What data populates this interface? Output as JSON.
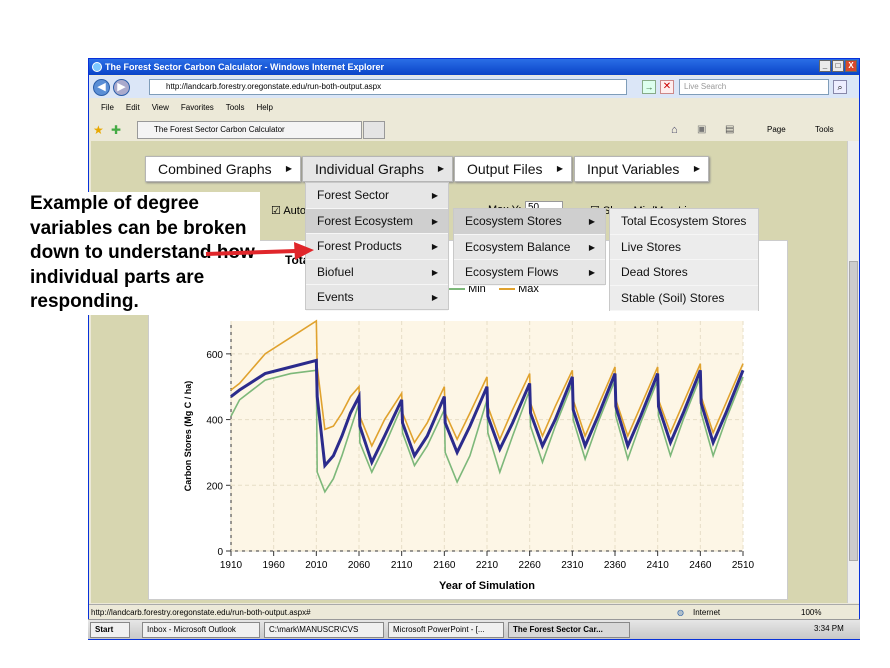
{
  "window": {
    "title": "The Forest Sector Carbon Calculator - Windows Internet Explorer",
    "controls": [
      "_",
      "□",
      "X"
    ]
  },
  "address": {
    "url": "http://landcarb.forestry.oregonstate.edu/run-both-output.aspx",
    "search_placeholder": "Live Search"
  },
  "menu": [
    "File",
    "Edit",
    "View",
    "Favorites",
    "Tools",
    "Help"
  ],
  "tab": {
    "label": "The Forest Sector Carbon Calculator"
  },
  "toolbar": {
    "page": "Page",
    "tools": "Tools"
  },
  "nav": [
    {
      "label": "Combined Graphs"
    },
    {
      "label": "Individual Graphs"
    },
    {
      "label": "Output Files"
    },
    {
      "label": "Input Variables"
    }
  ],
  "dropdown1": [
    "Forest Sector",
    "Forest Ecosystem",
    "Forest Products",
    "Biofuel",
    "Events"
  ],
  "dropdown2": [
    "Ecosystem Stores",
    "Ecosystem Balance",
    "Ecosystem Flows"
  ],
  "dropdown3": [
    "Total Ecosystem Stores",
    "Live Stores",
    "Dead Stores",
    "Stable (Soil) Stores"
  ],
  "partial": {
    "auto": "Auto",
    "maxy": "Max Y:",
    "maxy_value": "50",
    "showminmax": "Show Min/Max Lines",
    "title_fragment": "Tota",
    "legend_min": "Min",
    "legend_max": "Max"
  },
  "callout": "Example of degree variables can be broken down to understand how individual parts are responding.",
  "status": {
    "url": "http://landcarb.forestry.oregonstate.edu/run-both-output.aspx#",
    "zone": "Internet",
    "zoom": "100%"
  },
  "taskbar": {
    "start": "Start",
    "items": [
      "Inbox - Microsoft Outlook",
      "C:\\mark\\MANUSCR\\CVS",
      "Microsoft PowerPoint - [...",
      "The Forest Sector Car..."
    ],
    "time": "3:34 PM"
  },
  "colors": {
    "accent": "#e0262b",
    "mean": "#2b2b8c",
    "max": "#e0a22e",
    "min": "#7db87a"
  },
  "chart_data": {
    "type": "line",
    "xlabel": "Year of Simulation",
    "ylabel": "Carbon Stores (Mg C / ha)",
    "xlim": [
      1910,
      2510
    ],
    "ylim": [
      0,
      700
    ],
    "xticks": [
      1910,
      1960,
      2010,
      2060,
      2110,
      2160,
      2210,
      2260,
      2310,
      2360,
      2410,
      2460,
      2510
    ],
    "yticks": [
      0,
      200,
      400,
      600
    ],
    "series": [
      {
        "name": "Max",
        "color": "#e0a22e",
        "x": [
          1910,
          1920,
          1950,
          1980,
          2010,
          2011,
          2020,
          2030,
          2040,
          2050,
          2060,
          2061,
          2075,
          2090,
          2110,
          2111,
          2125,
          2140,
          2160,
          2161,
          2175,
          2190,
          2210,
          2211,
          2225,
          2240,
          2260,
          2261,
          2275,
          2290,
          2310,
          2311,
          2325,
          2340,
          2360,
          2361,
          2375,
          2390,
          2410,
          2411,
          2425,
          2440,
          2460,
          2461,
          2475,
          2490,
          2510
        ],
        "y": [
          490,
          510,
          600,
          650,
          700,
          560,
          370,
          380,
          420,
          470,
          500,
          410,
          320,
          400,
          480,
          420,
          330,
          390,
          500,
          420,
          340,
          420,
          530,
          440,
          340,
          430,
          540,
          450,
          350,
          440,
          550,
          460,
          350,
          440,
          560,
          460,
          350,
          440,
          560,
          460,
          360,
          450,
          570,
          470,
          360,
          450,
          570
        ]
      },
      {
        "name": "Mean",
        "color": "#2b2b8c",
        "x": [
          1910,
          1920,
          1950,
          1980,
          2010,
          2011,
          2020,
          2030,
          2040,
          2050,
          2060,
          2061,
          2075,
          2090,
          2110,
          2111,
          2125,
          2140,
          2160,
          2161,
          2175,
          2190,
          2210,
          2211,
          2225,
          2240,
          2260,
          2261,
          2275,
          2290,
          2310,
          2311,
          2325,
          2340,
          2360,
          2361,
          2375,
          2390,
          2410,
          2411,
          2425,
          2440,
          2460,
          2461,
          2475,
          2490,
          2510
        ],
        "y": [
          470,
          490,
          540,
          560,
          580,
          470,
          260,
          290,
          350,
          420,
          470,
          380,
          270,
          350,
          460,
          390,
          290,
          350,
          470,
          390,
          300,
          380,
          500,
          410,
          310,
          390,
          510,
          420,
          320,
          400,
          530,
          430,
          320,
          410,
          540,
          440,
          320,
          410,
          540,
          440,
          330,
          420,
          550,
          450,
          330,
          420,
          550
        ]
      },
      {
        "name": "Min",
        "color": "#7db87a",
        "x": [
          1910,
          1920,
          1950,
          1980,
          2010,
          2011,
          2020,
          2030,
          2040,
          2050,
          2060,
          2061,
          2075,
          2090,
          2110,
          2111,
          2125,
          2140,
          2160,
          2161,
          2175,
          2190,
          2210,
          2211,
          2225,
          2240,
          2260,
          2261,
          2275,
          2290,
          2310,
          2311,
          2325,
          2340,
          2360,
          2361,
          2375,
          2390,
          2410,
          2411,
          2425,
          2440,
          2460,
          2461,
          2475,
          2490,
          2510
        ],
        "y": [
          410,
          460,
          520,
          540,
          550,
          240,
          180,
          220,
          290,
          370,
          450,
          330,
          240,
          320,
          440,
          360,
          260,
          320,
          430,
          300,
          210,
          290,
          460,
          360,
          240,
          350,
          490,
          380,
          270,
          380,
          510,
          400,
          280,
          390,
          520,
          410,
          280,
          390,
          520,
          410,
          290,
          400,
          530,
          420,
          290,
          400,
          530
        ]
      }
    ]
  }
}
